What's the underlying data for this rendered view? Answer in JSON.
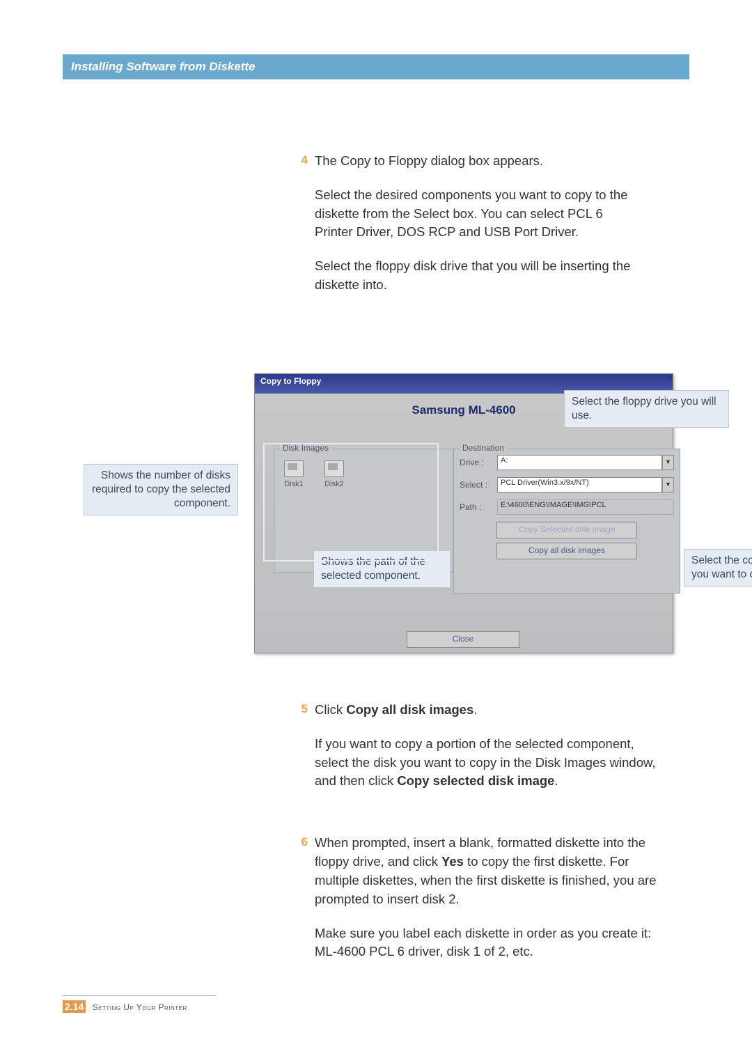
{
  "header": {
    "title": "Installing Software from Diskette"
  },
  "steps": {
    "s4": {
      "num": "4",
      "p1": "The Copy to Floppy dialog box appears.",
      "p2": "Select the desired components you want to copy to the diskette from the Select box. You can select PCL 6 Printer Driver, DOS RCP and  USB Port Driver.",
      "p3": "Select the floppy disk drive that you will be inserting the diskette into."
    },
    "s5": {
      "num": "5",
      "p1a": "Click ",
      "p1b": "Copy all disk images",
      "p1c": ".",
      "p2a": "If you want to copy a portion of the selected component, select the disk you want to copy in the Disk Images window, and then click ",
      "p2b": "Copy selected disk image",
      "p2c": "."
    },
    "s6": {
      "num": "6",
      "p1a": "When prompted, insert a blank, formatted diskette into the floppy drive, and click ",
      "p1b": "Yes",
      "p1c": " to copy the first diskette. For multiple diskettes, when the first diskette is finished, you are prompted to insert disk 2.",
      "p2": "Make sure you label each diskette in order as you create it: ML-4600 PCL 6 driver, disk 1 of 2, etc."
    }
  },
  "dialog": {
    "title": "Copy to Floppy",
    "brand": "Samsung ML-4600",
    "disk_images_label": "Disk Images",
    "disk1": "Disk1",
    "disk2": "Disk2",
    "destination_label": "Destination",
    "drive_label": "Drive :",
    "drive_value": "A:",
    "select_label": "Select :",
    "select_value": "PCL Driver(Win3.x/9x/NT)",
    "path_label": "Path :",
    "path_value": "E:\\4600\\ENG\\IMAGE\\IMG\\PCL",
    "btn_copy_selected": "Copy Selected disk image",
    "btn_copy_all": "Copy all disk images",
    "btn_close": "Close"
  },
  "callouts": {
    "left": "Shows the number of disks required to copy the selected component.",
    "path": "Shows the path of the selected component.",
    "drive": "Select the floppy drive you will use.",
    "select": "Select the component you want to copy."
  },
  "footer": {
    "chapter": "2.",
    "page": "14",
    "label": "Setting Up Your Printer"
  }
}
